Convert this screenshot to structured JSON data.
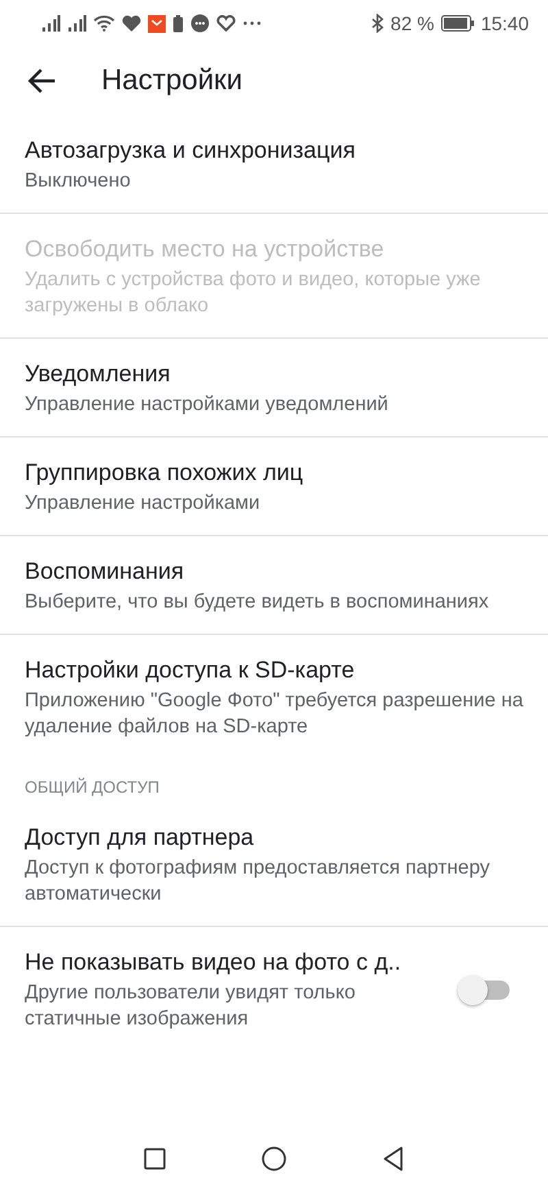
{
  "status_bar": {
    "battery": "82 %",
    "time": "15:40"
  },
  "header": {
    "title": "Настройки"
  },
  "sections": [
    {
      "items": [
        {
          "kind": "plain",
          "title": "Автозагрузка и синхронизация",
          "subtitle": "Выключено",
          "disabled": false
        },
        {
          "kind": "plain",
          "title": "Освободить место на устройстве",
          "subtitle": "Удалить с устройства фото и видео, которые уже загружены в облако",
          "disabled": true
        },
        {
          "kind": "plain",
          "title": "Уведомления",
          "subtitle": "Управление настройками уведомлений",
          "disabled": false
        },
        {
          "kind": "plain",
          "title": "Группировка похожих лиц",
          "subtitle": "Управление настройками",
          "disabled": false
        },
        {
          "kind": "plain",
          "title": "Воспоминания",
          "subtitle": "Выберите, что вы будете видеть в воспоминаниях",
          "disabled": false
        },
        {
          "kind": "plain",
          "title": "Настройки доступа к SD-карте",
          "subtitle": "Приложению \"Google Фото\" требуется разрешение на удаление файлов на SD-карте",
          "disabled": false
        }
      ]
    },
    {
      "header": "ОБЩИЙ ДОСТУП",
      "items": [
        {
          "kind": "plain",
          "title": "Доступ для партнера",
          "subtitle": "Доступ к фотографиям предоставляется партнеру автоматически",
          "disabled": false
        },
        {
          "kind": "toggle",
          "title": "Не показывать видео на фото с д..",
          "subtitle": "Другие пользователи увидят только статичные изображения",
          "disabled": false,
          "on": false
        }
      ]
    }
  ]
}
